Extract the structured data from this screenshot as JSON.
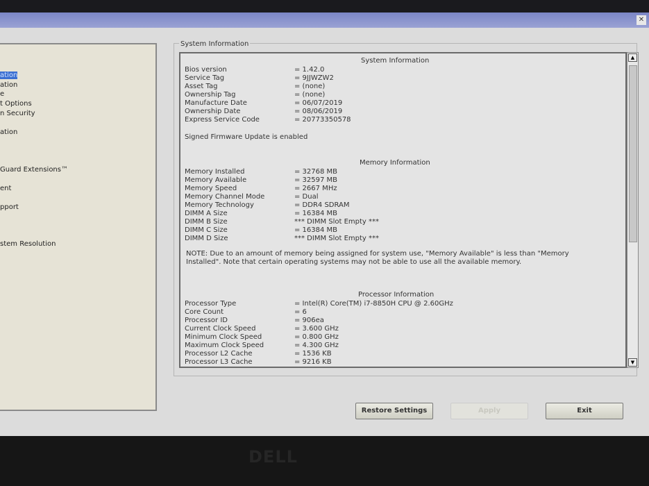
{
  "nav": {
    "items": [
      "ation",
      "ation",
      "e",
      "t Options",
      "n Security",
      "ation",
      "Guard Extensions™",
      "ent",
      "pport",
      "stem Resolution"
    ]
  },
  "group_label": "System Information",
  "system": {
    "heading": "System Information",
    "rows": [
      [
        "Bios version",
        "= 1.42.0"
      ],
      [
        "Service Tag",
        "= 9JJWZW2"
      ],
      [
        "Asset Tag",
        "= (none)"
      ],
      [
        "Ownership Tag",
        "= (none)"
      ],
      [
        "Manufacture Date",
        "= 06/07/2019"
      ],
      [
        "Ownership Date",
        "= 08/06/2019"
      ],
      [
        "Express Service Code",
        "= 20773350578"
      ]
    ],
    "firmware": "Signed Firmware Update is enabled"
  },
  "memory": {
    "heading": "Memory Information",
    "rows": [
      [
        "Memory Installed",
        "= 32768 MB"
      ],
      [
        "Memory Available",
        "= 32597 MB"
      ],
      [
        "Memory Speed",
        "= 2667 MHz"
      ],
      [
        "Memory Channel Mode",
        "= Dual"
      ],
      [
        "Memory Technology",
        "= DDR4 SDRAM"
      ],
      [
        "DIMM A Size",
        "= 16384 MB"
      ],
      [
        "DIMM B Size",
        "*** DIMM Slot Empty ***"
      ],
      [
        "DIMM C Size",
        "= 16384 MB"
      ],
      [
        "DIMM D Size",
        "*** DIMM Slot Empty ***"
      ]
    ],
    "note": "NOTE: Due to an amount of memory being assigned for system use, \"Memory Available\" is less than \"Memory Installed\". Note that certain operating systems may not be able to use all the available memory."
  },
  "processor": {
    "heading": "Processor Information",
    "rows": [
      [
        "Processor Type",
        "= Intel(R) Core(TM) i7-8850H CPU @ 2.60GHz"
      ],
      [
        "Core Count",
        "= 6"
      ],
      [
        "Processor ID",
        "= 906ea"
      ],
      [
        "Current Clock Speed",
        "= 3.600 GHz"
      ],
      [
        "Minimum Clock Speed",
        "= 0.800 GHz"
      ],
      [
        "Maximum Clock Speed",
        "= 4.300 GHz"
      ],
      [
        "Processor L2 Cache",
        "= 1536 KB"
      ],
      [
        "Processor L3 Cache",
        "= 9216 KB"
      ]
    ]
  },
  "buttons": {
    "restore": "Restore Settings",
    "apply": "Apply",
    "exit": "Exit"
  },
  "logo": "DELL"
}
